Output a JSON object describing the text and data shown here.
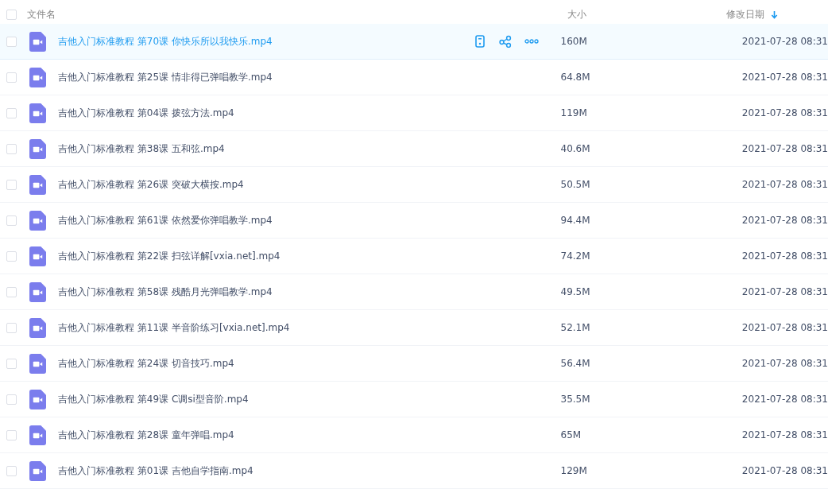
{
  "header": {
    "checked": false,
    "name": "文件名",
    "size": "大小",
    "date": "修改日期",
    "sort_descending": true
  },
  "rows": [
    {
      "name": "吉他入门标准教程 第70课 你快乐所以我快乐.mp4",
      "size": "160M",
      "date": "2021-07-28 08:31",
      "selected": true,
      "checked": false
    },
    {
      "name": "吉他入门标准教程 第25课 情非得已弹唱教学.mp4",
      "size": "64.8M",
      "date": "2021-07-28 08:31",
      "selected": false,
      "checked": false
    },
    {
      "name": "吉他入门标准教程 第04课 拨弦方法.mp4",
      "size": "119M",
      "date": "2021-07-28 08:31",
      "selected": false,
      "checked": false
    },
    {
      "name": "吉他入门标准教程 第38课 五和弦.mp4",
      "size": "40.6M",
      "date": "2021-07-28 08:31",
      "selected": false,
      "checked": false
    },
    {
      "name": "吉他入门标准教程 第26课 突破大横按.mp4",
      "size": "50.5M",
      "date": "2021-07-28 08:31",
      "selected": false,
      "checked": false
    },
    {
      "name": "吉他入门标准教程 第61课 依然爱你弹唱教学.mp4",
      "size": "94.4M",
      "date": "2021-07-28 08:31",
      "selected": false,
      "checked": false
    },
    {
      "name": "吉他入门标准教程 第22课 扫弦详解[vxia.net].mp4",
      "size": "74.2M",
      "date": "2021-07-28 08:31",
      "selected": false,
      "checked": false
    },
    {
      "name": "吉他入门标准教程 第58课 残酷月光弹唱教学.mp4",
      "size": "49.5M",
      "date": "2021-07-28 08:31",
      "selected": false,
      "checked": false
    },
    {
      "name": "吉他入门标准教程 第11课 半音阶练习[vxia.net].mp4",
      "size": "52.1M",
      "date": "2021-07-28 08:31",
      "selected": false,
      "checked": false
    },
    {
      "name": "吉他入门标准教程 第24课 切音技巧.mp4",
      "size": "56.4M",
      "date": "2021-07-28 08:31",
      "selected": false,
      "checked": false
    },
    {
      "name": "吉他入门标准教程 第49课 C调si型音阶.mp4",
      "size": "35.5M",
      "date": "2021-07-28 08:31",
      "selected": false,
      "checked": false
    },
    {
      "name": "吉他入门标准教程 第28课 童年弹唱.mp4",
      "size": "65M",
      "date": "2021-07-28 08:31",
      "selected": false,
      "checked": false
    },
    {
      "name": "吉他入门标准教程 第01课 吉他自学指南.mp4",
      "size": "129M",
      "date": "2021-07-28 08:31",
      "selected": false,
      "checked": false
    }
  ]
}
